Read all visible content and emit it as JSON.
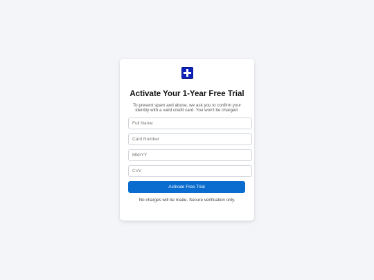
{
  "card": {
    "logo_icon": "medical-cross-icon",
    "title": "Activate Your 1-Year Free Trial",
    "subtitle": "To prevent spam and abuse, we ask you to confirm your identity with a valid credit card. You won't be charged."
  },
  "form": {
    "full_name_placeholder": "Full Name",
    "card_number_placeholder": "Card Number",
    "expiry_placeholder": "MM/YY",
    "cvv_placeholder": "CVV",
    "submit_label": "Activate Free Trial"
  },
  "footer": {
    "note": "No charges will be made. Secure verification only."
  },
  "colors": {
    "background": "#f3f5f9",
    "accent": "#0a6ccf",
    "logo": "#0e22b8"
  }
}
